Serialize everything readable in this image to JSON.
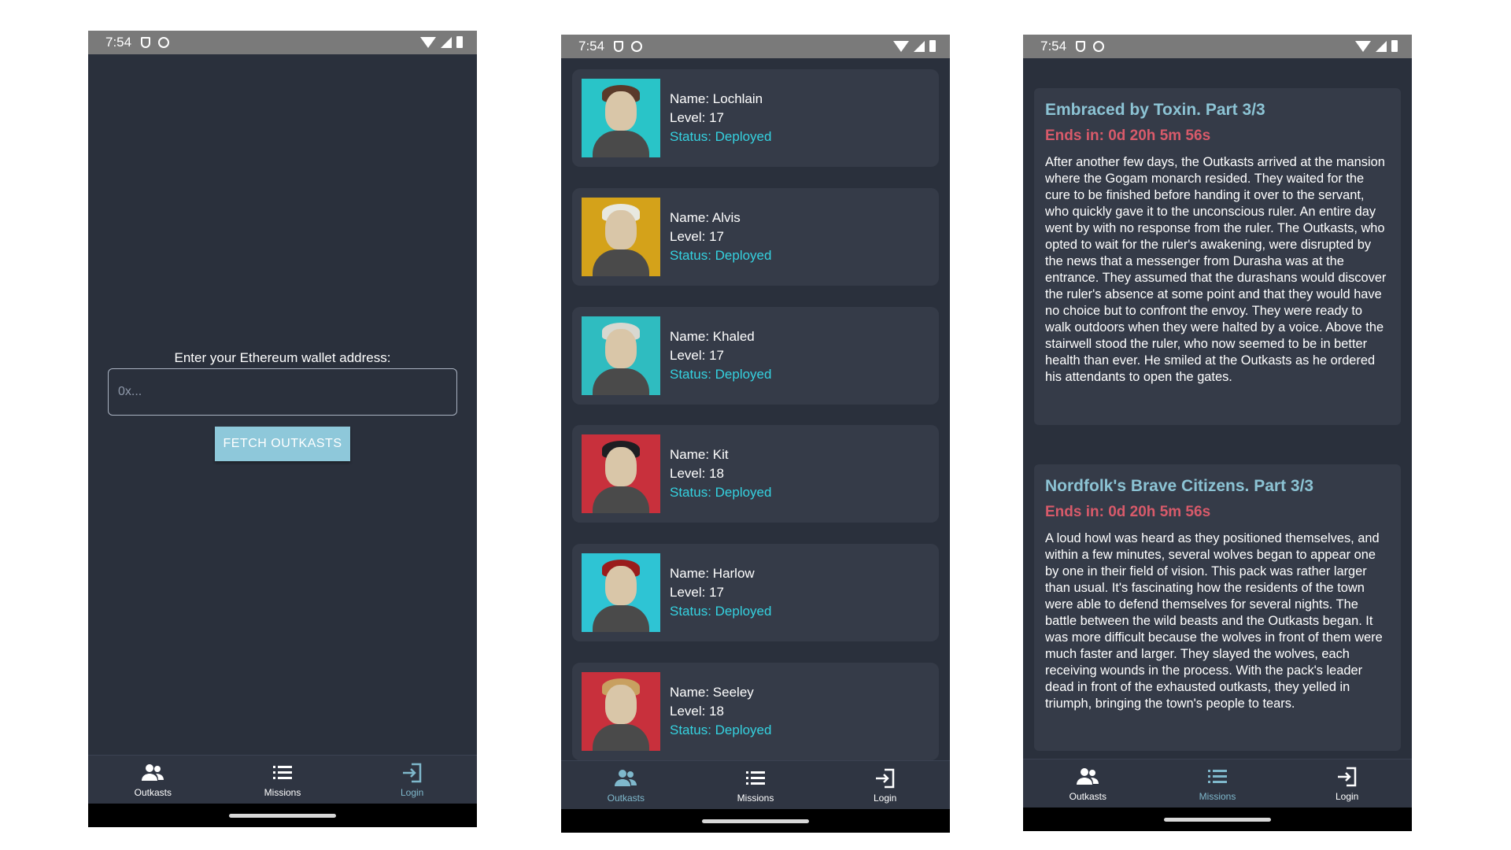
{
  "status_bar": {
    "time": "7:54"
  },
  "nav": {
    "outkasts": "Outkasts",
    "missions": "Missions",
    "login": "Login"
  },
  "login_screen": {
    "label": "Enter your Ethereum wallet address:",
    "input_placeholder": "0x...",
    "input_value": "",
    "fetch_button": "FETCH OUTKASTS"
  },
  "outkasts": [
    {
      "name": "Name: Lochlain",
      "level": "Level: 17",
      "status": "Status: Deployed",
      "bg": "#29c4c8",
      "hair": "#5a3a2a"
    },
    {
      "name": "Name: Alvis",
      "level": "Level: 17",
      "status": "Status: Deployed",
      "bg": "#d4a21a",
      "hair": "#e8e8e0"
    },
    {
      "name": "Name: Khaled",
      "level": "Level: 17",
      "status": "Status: Deployed",
      "bg": "#2fbcc0",
      "hair": "#d8d8d0"
    },
    {
      "name": "Name: Kit",
      "level": "Level: 18",
      "status": "Status: Deployed",
      "bg": "#c8303c",
      "hair": "#1e1e22"
    },
    {
      "name": "Name: Harlow",
      "level": "Level: 17",
      "status": "Status: Deployed",
      "bg": "#2ec4d4",
      "hair": "#9a1c1c"
    },
    {
      "name": "Name: Seeley",
      "level": "Level: 18",
      "status": "Status: Deployed",
      "bg": "#c8303c",
      "hair": "#c8a060"
    }
  ],
  "missions": [
    {
      "title": "Embraced by Toxin. Part 3/3",
      "ends": "Ends in: 0d 20h 5m 56s",
      "text": "After another few days, the Outkasts arrived at the mansion where the Gogam monarch resided. They waited for the cure to be finished before handing it over to the servant, who quickly gave it to the unconscious ruler. An entire day went by with no response from the ruler. The Outkasts, who opted to wait for the ruler's awakening, were disrupted by the news that a messenger from Durasha was at the entrance. They assumed that the durashans would discover the ruler's absence at some point and that they would have no choice but to confront the envoy. They were ready to walk outdoors when they were halted by a voice. Above the stairwell stood the ruler, who now seemed to be in better health than ever. He smiled at the Outkasts as he ordered his attendants to open the gates."
    },
    {
      "title": "Nordfolk's Brave Citizens. Part 3/3",
      "ends": "Ends in: 0d 20h 5m 56s",
      "text": "A loud howl was heard as they positioned themselves, and within a few minutes, several wolves began to appear one by one in their field of vision. This pack was rather larger than usual. It's fascinating how the residents of the town were able to defend themselves for several nights. The battle between the wild beasts and the Outkasts began. It was more difficult because the wolves in front of them were much faster and larger. They slayed the wolves, each receiving wounds in the process. With the pack's leader dead in front of the exhausted outkasts, they yelled in triumph, bringing the town's people to tears."
    }
  ]
}
